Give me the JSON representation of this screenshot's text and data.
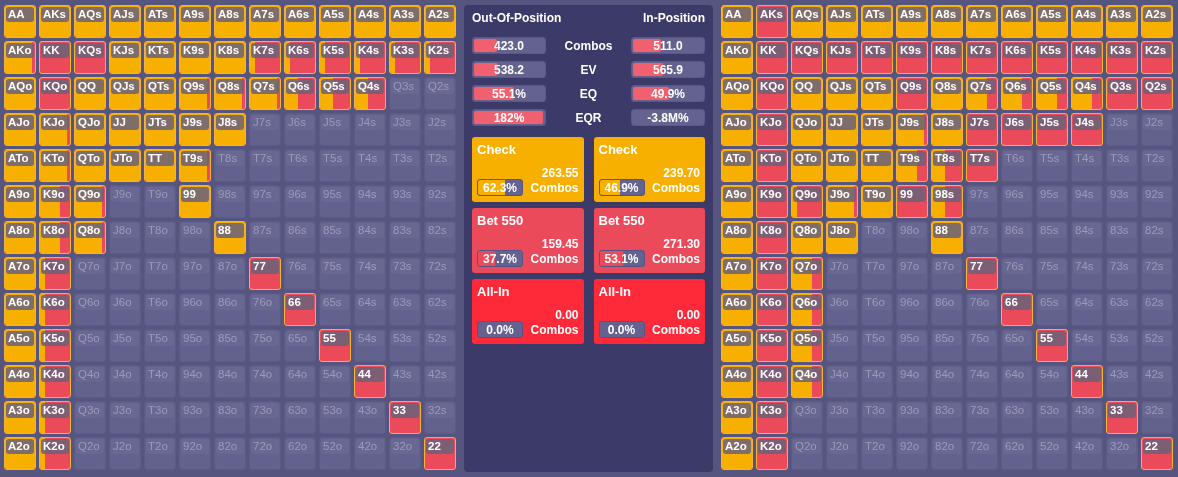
{
  "oop_grid": [
    [
      {
        "hand": "AA",
        "active": true,
        "kind": "check"
      },
      {
        "hand": "AKs",
        "active": true,
        "kind": "check"
      },
      {
        "hand": "AQs",
        "active": true,
        "kind": "check"
      },
      {
        "hand": "AJs",
        "active": true,
        "kind": "check"
      },
      {
        "hand": "ATs",
        "active": true,
        "kind": "check"
      },
      {
        "hand": "A9s",
        "active": true,
        "kind": "check"
      },
      {
        "hand": "A8s",
        "active": true,
        "kind": "check"
      },
      {
        "hand": "A7s",
        "active": true,
        "kind": "check"
      },
      {
        "hand": "A6s",
        "active": true,
        "kind": "check"
      },
      {
        "hand": "A5s",
        "active": true,
        "kind": "check"
      },
      {
        "hand": "A4s",
        "active": true,
        "kind": "check"
      },
      {
        "hand": "A3s",
        "active": true,
        "kind": "check"
      },
      {
        "hand": "A2s",
        "active": true,
        "kind": "check"
      }
    ],
    [
      {
        "hand": "AKo",
        "active": true,
        "kind": "mostly_check"
      },
      {
        "hand": "KK",
        "active": true,
        "kind": "bet"
      },
      {
        "hand": "KQs",
        "active": true,
        "kind": "bet"
      },
      {
        "hand": "KJs",
        "active": true,
        "kind": "check"
      },
      {
        "hand": "KTs",
        "active": true,
        "kind": "check"
      },
      {
        "hand": "K9s",
        "active": true,
        "kind": "check"
      },
      {
        "hand": "K8s",
        "active": true,
        "kind": "check"
      },
      {
        "hand": "K7s",
        "active": true,
        "kind": "mostly_bet"
      },
      {
        "hand": "K6s",
        "active": true,
        "kind": "mostly_bet"
      },
      {
        "hand": "K5s",
        "active": true,
        "kind": "mostly_bet"
      },
      {
        "hand": "K4s",
        "active": true,
        "kind": "mostly_bet"
      },
      {
        "hand": "K3s",
        "active": true,
        "kind": "mostly_bet"
      },
      {
        "hand": "K2s",
        "active": true,
        "kind": "mostly_bet"
      }
    ],
    [
      {
        "hand": "AQo",
        "active": true,
        "kind": "check"
      },
      {
        "hand": "KQo",
        "active": true,
        "kind": "bet"
      },
      {
        "hand": "QQ",
        "active": true,
        "kind": "check"
      },
      {
        "hand": "QJs",
        "active": true,
        "kind": "check"
      },
      {
        "hand": "QTs",
        "active": true,
        "kind": "check"
      },
      {
        "hand": "Q9s",
        "active": true,
        "kind": "mostly_check"
      },
      {
        "hand": "Q8s",
        "active": true,
        "kind": "mostly_check"
      },
      {
        "hand": "Q7s",
        "active": true,
        "kind": "mostly_check"
      },
      {
        "hand": "Q6s",
        "active": true,
        "kind": "split"
      },
      {
        "hand": "Q5s",
        "active": true,
        "kind": "split"
      },
      {
        "hand": "Q4s",
        "active": true,
        "kind": "split"
      },
      {
        "hand": "Q3s",
        "active": false
      },
      {
        "hand": "Q2s",
        "active": false
      }
    ],
    [
      {
        "hand": "AJo",
        "active": true,
        "kind": "check"
      },
      {
        "hand": "KJo",
        "active": true,
        "kind": "mostly_check"
      },
      {
        "hand": "QJo",
        "active": true,
        "kind": "check"
      },
      {
        "hand": "JJ",
        "active": true,
        "kind": "check"
      },
      {
        "hand": "JTs",
        "active": true,
        "kind": "check"
      },
      {
        "hand": "J9s",
        "active": true,
        "kind": "check"
      },
      {
        "hand": "J8s",
        "active": true,
        "kind": "check"
      },
      {
        "hand": "J7s",
        "active": false
      },
      {
        "hand": "J6s",
        "active": false
      },
      {
        "hand": "J5s",
        "active": false
      },
      {
        "hand": "J4s",
        "active": false
      },
      {
        "hand": "J3s",
        "active": false
      },
      {
        "hand": "J2s",
        "active": false
      }
    ],
    [
      {
        "hand": "ATo",
        "active": true,
        "kind": "check"
      },
      {
        "hand": "KTo",
        "active": true,
        "kind": "mostly_check"
      },
      {
        "hand": "QTo",
        "active": true,
        "kind": "check"
      },
      {
        "hand": "JTo",
        "active": true,
        "kind": "check"
      },
      {
        "hand": "TT",
        "active": true,
        "kind": "check"
      },
      {
        "hand": "T9s",
        "active": true,
        "kind": "mostly_check"
      },
      {
        "hand": "T8s",
        "active": false
      },
      {
        "hand": "T7s",
        "active": false
      },
      {
        "hand": "T6s",
        "active": false
      },
      {
        "hand": "T5s",
        "active": false
      },
      {
        "hand": "T4s",
        "active": false
      },
      {
        "hand": "T3s",
        "active": false
      },
      {
        "hand": "T2s",
        "active": false
      }
    ],
    [
      {
        "hand": "A9o",
        "active": true,
        "kind": "check"
      },
      {
        "hand": "K9o",
        "active": true,
        "kind": "check_bet"
      },
      {
        "hand": "Q9o",
        "active": true,
        "kind": "mostly_check"
      },
      {
        "hand": "J9o",
        "active": false
      },
      {
        "hand": "T9o",
        "active": false
      },
      {
        "hand": "99",
        "active": true,
        "kind": "check"
      },
      {
        "hand": "98s",
        "active": false
      },
      {
        "hand": "97s",
        "active": false
      },
      {
        "hand": "96s",
        "active": false
      },
      {
        "hand": "95s",
        "active": false
      },
      {
        "hand": "94s",
        "active": false
      },
      {
        "hand": "93s",
        "active": false
      },
      {
        "hand": "92s",
        "active": false
      }
    ],
    [
      {
        "hand": "A8o",
        "active": true,
        "kind": "check"
      },
      {
        "hand": "K8o",
        "active": true,
        "kind": "check_bet"
      },
      {
        "hand": "Q8o",
        "active": true,
        "kind": "mostly_check"
      },
      {
        "hand": "J8o",
        "active": false
      },
      {
        "hand": "T8o",
        "active": false
      },
      {
        "hand": "98o",
        "active": false
      },
      {
        "hand": "88",
        "active": true,
        "kind": "check"
      },
      {
        "hand": "87s",
        "active": false
      },
      {
        "hand": "86s",
        "active": false
      },
      {
        "hand": "85s",
        "active": false
      },
      {
        "hand": "84s",
        "active": false
      },
      {
        "hand": "83s",
        "active": false
      },
      {
        "hand": "82s",
        "active": false
      }
    ],
    [
      {
        "hand": "A7o",
        "active": true,
        "kind": "check"
      },
      {
        "hand": "K7o",
        "active": true,
        "kind": "mostly_bet"
      },
      {
        "hand": "Q7o",
        "active": false
      },
      {
        "hand": "J7o",
        "active": false
      },
      {
        "hand": "T7o",
        "active": false
      },
      {
        "hand": "97o",
        "active": false
      },
      {
        "hand": "87o",
        "active": false
      },
      {
        "hand": "77",
        "active": true,
        "kind": "bet"
      },
      {
        "hand": "76s",
        "active": false
      },
      {
        "hand": "75s",
        "active": false
      },
      {
        "hand": "74s",
        "active": false
      },
      {
        "hand": "73s",
        "active": false
      },
      {
        "hand": "72s",
        "active": false
      }
    ],
    [
      {
        "hand": "A6o",
        "active": true,
        "kind": "check"
      },
      {
        "hand": "K6o",
        "active": true,
        "kind": "mostly_bet"
      },
      {
        "hand": "Q6o",
        "active": false
      },
      {
        "hand": "J6o",
        "active": false
      },
      {
        "hand": "T6o",
        "active": false
      },
      {
        "hand": "96o",
        "active": false
      },
      {
        "hand": "86o",
        "active": false
      },
      {
        "hand": "76o",
        "active": false
      },
      {
        "hand": "66",
        "active": true,
        "kind": "bet"
      },
      {
        "hand": "65s",
        "active": false
      },
      {
        "hand": "64s",
        "active": false
      },
      {
        "hand": "63s",
        "active": false
      },
      {
        "hand": "62s",
        "active": false
      }
    ],
    [
      {
        "hand": "A5o",
        "active": true,
        "kind": "check"
      },
      {
        "hand": "K5o",
        "active": true,
        "kind": "mostly_bet"
      },
      {
        "hand": "Q5o",
        "active": false
      },
      {
        "hand": "J5o",
        "active": false
      },
      {
        "hand": "T5o",
        "active": false
      },
      {
        "hand": "95o",
        "active": false
      },
      {
        "hand": "85o",
        "active": false
      },
      {
        "hand": "75o",
        "active": false
      },
      {
        "hand": "65o",
        "active": false
      },
      {
        "hand": "55",
        "active": true,
        "kind": "bet"
      },
      {
        "hand": "54s",
        "active": false
      },
      {
        "hand": "53s",
        "active": false
      },
      {
        "hand": "52s",
        "active": false
      }
    ],
    [
      {
        "hand": "A4o",
        "active": true,
        "kind": "check"
      },
      {
        "hand": "K4o",
        "active": true,
        "kind": "mostly_bet"
      },
      {
        "hand": "Q4o",
        "active": false
      },
      {
        "hand": "J4o",
        "active": false
      },
      {
        "hand": "T4o",
        "active": false
      },
      {
        "hand": "94o",
        "active": false
      },
      {
        "hand": "84o",
        "active": false
      },
      {
        "hand": "74o",
        "active": false
      },
      {
        "hand": "64o",
        "active": false
      },
      {
        "hand": "54o",
        "active": false
      },
      {
        "hand": "44",
        "active": true,
        "kind": "bet"
      },
      {
        "hand": "43s",
        "active": false
      },
      {
        "hand": "42s",
        "active": false
      }
    ],
    [
      {
        "hand": "A3o",
        "active": true,
        "kind": "check"
      },
      {
        "hand": "K3o",
        "active": true,
        "kind": "mostly_bet"
      },
      {
        "hand": "Q3o",
        "active": false
      },
      {
        "hand": "J3o",
        "active": false
      },
      {
        "hand": "T3o",
        "active": false
      },
      {
        "hand": "93o",
        "active": false
      },
      {
        "hand": "83o",
        "active": false
      },
      {
        "hand": "73o",
        "active": false
      },
      {
        "hand": "63o",
        "active": false
      },
      {
        "hand": "53o",
        "active": false
      },
      {
        "hand": "43o",
        "active": false
      },
      {
        "hand": "33",
        "active": true,
        "kind": "bet"
      },
      {
        "hand": "32s",
        "active": false
      }
    ],
    [
      {
        "hand": "A2o",
        "active": true,
        "kind": "check"
      },
      {
        "hand": "K2o",
        "active": true,
        "kind": "mostly_bet"
      },
      {
        "hand": "Q2o",
        "active": false
      },
      {
        "hand": "J2o",
        "active": false
      },
      {
        "hand": "T2o",
        "active": false
      },
      {
        "hand": "92o",
        "active": false
      },
      {
        "hand": "82o",
        "active": false
      },
      {
        "hand": "72o",
        "active": false
      },
      {
        "hand": "62o",
        "active": false
      },
      {
        "hand": "52o",
        "active": false
      },
      {
        "hand": "42o",
        "active": false
      },
      {
        "hand": "32o",
        "active": false
      },
      {
        "hand": "22",
        "active": true,
        "kind": "bet"
      }
    ]
  ],
  "panel": {
    "oop_title": "Out-Of-Position",
    "ip_title": "In-Position",
    "stats": [
      {
        "label": "Combos",
        "oop": {
          "value": "423.0",
          "level": 0.32
        },
        "ip": {
          "value": "511.0",
          "level": 0.39
        }
      },
      {
        "label": "EV",
        "oop": {
          "value": "538.2",
          "level": 0.34
        },
        "ip": {
          "value": "565.9",
          "level": 0.41
        }
      },
      {
        "label": "EQ",
        "oop": {
          "value": "55.1%",
          "level": 0.551
        },
        "ip": {
          "value": "49.9%",
          "level": 0.499
        }
      },
      {
        "label": "EQR",
        "oop": {
          "value": "182%",
          "level": 1
        },
        "ip": {
          "value": "-3.8M%"
        }
      }
    ],
    "oop_actions": [
      {
        "name": "Check",
        "color": "#f8b000",
        "combos": "263.55",
        "combos_label": "Combos",
        "percent": "62.3%",
        "level": 0.623
      },
      {
        "name": "Bet 550",
        "color": "#eb4a5a",
        "combos": "159.45",
        "combos_label": "Combos",
        "percent": "37.7%",
        "level": 0.377
      },
      {
        "name": "All-In",
        "color": "#fe2a3a",
        "combos": "0.00",
        "combos_label": "Combos",
        "percent": "0.0%"
      }
    ],
    "ip_actions": [
      {
        "name": "Check",
        "color": "#f8b000",
        "combos": "239.70",
        "combos_label": "Combos",
        "percent": "46.9%",
        "level": 0.469
      },
      {
        "name": "Bet 550",
        "color": "#eb4a5a",
        "combos": "271.30",
        "combos_label": "Combos",
        "percent": "53.1%",
        "level": 0.531
      },
      {
        "name": "All-In",
        "color": "#fe2a3a",
        "combos": "0.00",
        "combos_label": "Combos",
        "percent": "0.0%"
      }
    ]
  },
  "ip_grid": [
    [
      {
        "hand": "AA",
        "active": true,
        "kind": "check"
      },
      {
        "hand": "AKs",
        "active": true,
        "kind": "bet"
      },
      {
        "hand": "AQs",
        "active": true,
        "kind": "check"
      },
      {
        "hand": "AJs",
        "active": true,
        "kind": "check"
      },
      {
        "hand": "ATs",
        "active": true,
        "kind": "check"
      },
      {
        "hand": "A9s",
        "active": true,
        "kind": "check"
      },
      {
        "hand": "A8s",
        "active": true,
        "kind": "check"
      },
      {
        "hand": "A7s",
        "active": true,
        "kind": "check"
      },
      {
        "hand": "A6s",
        "active": true,
        "kind": "check"
      },
      {
        "hand": "A5s",
        "active": true,
        "kind": "check"
      },
      {
        "hand": "A4s",
        "active": true,
        "kind": "check"
      },
      {
        "hand": "A3s",
        "active": true,
        "kind": "check"
      },
      {
        "hand": "A2s",
        "active": true,
        "kind": "check"
      }
    ],
    [
      {
        "hand": "AKo",
        "active": true,
        "kind": "check"
      },
      {
        "hand": "KK",
        "active": true,
        "kind": "bet"
      },
      {
        "hand": "KQs",
        "active": true,
        "kind": "bet"
      },
      {
        "hand": "KJs",
        "active": true,
        "kind": "bet"
      },
      {
        "hand": "KTs",
        "active": true,
        "kind": "bet"
      },
      {
        "hand": "K9s",
        "active": true,
        "kind": "bet"
      },
      {
        "hand": "K8s",
        "active": true,
        "kind": "bet"
      },
      {
        "hand": "K7s",
        "active": true,
        "kind": "bet"
      },
      {
        "hand": "K6s",
        "active": true,
        "kind": "bet"
      },
      {
        "hand": "K5s",
        "active": true,
        "kind": "bet"
      },
      {
        "hand": "K4s",
        "active": true,
        "kind": "bet"
      },
      {
        "hand": "K3s",
        "active": true,
        "kind": "bet"
      },
      {
        "hand": "K2s",
        "active": true,
        "kind": "bet"
      }
    ],
    [
      {
        "hand": "AQo",
        "active": true,
        "kind": "check"
      },
      {
        "hand": "KQo",
        "active": true,
        "kind": "bet"
      },
      {
        "hand": "QQ",
        "active": true,
        "kind": "check"
      },
      {
        "hand": "QJs",
        "active": true,
        "kind": "check"
      },
      {
        "hand": "QTs",
        "active": true,
        "kind": "check"
      },
      {
        "hand": "Q9s",
        "active": true,
        "kind": "bet"
      },
      {
        "hand": "Q8s",
        "active": true,
        "kind": "check"
      },
      {
        "hand": "Q7s",
        "active": true,
        "kind": "check_bet"
      },
      {
        "hand": "Q6s",
        "active": true,
        "kind": "check_bet"
      },
      {
        "hand": "Q5s",
        "active": true,
        "kind": "check_bet"
      },
      {
        "hand": "Q4s",
        "active": true,
        "kind": "check_bet"
      },
      {
        "hand": "Q3s",
        "active": true,
        "kind": "bet"
      },
      {
        "hand": "Q2s",
        "active": true,
        "kind": "bet"
      }
    ],
    [
      {
        "hand": "AJo",
        "active": true,
        "kind": "check"
      },
      {
        "hand": "KJo",
        "active": true,
        "kind": "bet"
      },
      {
        "hand": "QJo",
        "active": true,
        "kind": "check"
      },
      {
        "hand": "JJ",
        "active": true,
        "kind": "check"
      },
      {
        "hand": "JTs",
        "active": true,
        "kind": "check"
      },
      {
        "hand": "J9s",
        "active": true,
        "kind": "mostly_check"
      },
      {
        "hand": "J8s",
        "active": true,
        "kind": "check"
      },
      {
        "hand": "J7s",
        "active": true,
        "kind": "bet"
      },
      {
        "hand": "J6s",
        "active": true,
        "kind": "bet"
      },
      {
        "hand": "J5s",
        "active": true,
        "kind": "bet"
      },
      {
        "hand": "J4s",
        "active": true,
        "kind": "bet"
      },
      {
        "hand": "J3s",
        "active": false
      },
      {
        "hand": "J2s",
        "active": false
      }
    ],
    [
      {
        "hand": "ATo",
        "active": true,
        "kind": "check"
      },
      {
        "hand": "KTo",
        "active": true,
        "kind": "bet"
      },
      {
        "hand": "QTo",
        "active": true,
        "kind": "check"
      },
      {
        "hand": "JTo",
        "active": true,
        "kind": "check"
      },
      {
        "hand": "TT",
        "active": true,
        "kind": "check"
      },
      {
        "hand": "T9s",
        "active": true,
        "kind": "check_bet"
      },
      {
        "hand": "T8s",
        "active": true,
        "kind": "split"
      },
      {
        "hand": "T7s",
        "active": true,
        "kind": "bet"
      },
      {
        "hand": "T6s",
        "active": false
      },
      {
        "hand": "T5s",
        "active": false
      },
      {
        "hand": "T4s",
        "active": false
      },
      {
        "hand": "T3s",
        "active": false
      },
      {
        "hand": "T2s",
        "active": false
      }
    ],
    [
      {
        "hand": "A9o",
        "active": true,
        "kind": "check"
      },
      {
        "hand": "K9o",
        "active": true,
        "kind": "bet"
      },
      {
        "hand": "Q9o",
        "active": true,
        "kind": "mostly_bet"
      },
      {
        "hand": "J9o",
        "active": true,
        "kind": "mostly_check"
      },
      {
        "hand": "T9o",
        "active": true,
        "kind": "check"
      },
      {
        "hand": "99",
        "active": true,
        "kind": "bet"
      },
      {
        "hand": "98s",
        "active": true,
        "kind": "split"
      },
      {
        "hand": "97s",
        "active": false
      },
      {
        "hand": "96s",
        "active": false
      },
      {
        "hand": "95s",
        "active": false
      },
      {
        "hand": "94s",
        "active": false
      },
      {
        "hand": "93s",
        "active": false
      },
      {
        "hand": "92s",
        "active": false
      }
    ],
    [
      {
        "hand": "A8o",
        "active": true,
        "kind": "check"
      },
      {
        "hand": "K8o",
        "active": true,
        "kind": "bet"
      },
      {
        "hand": "Q8o",
        "active": true,
        "kind": "check"
      },
      {
        "hand": "J8o",
        "active": true,
        "kind": "check"
      },
      {
        "hand": "T8o",
        "active": false
      },
      {
        "hand": "98o",
        "active": false
      },
      {
        "hand": "88",
        "active": true,
        "kind": "check"
      },
      {
        "hand": "87s",
        "active": false
      },
      {
        "hand": "86s",
        "active": false
      },
      {
        "hand": "85s",
        "active": false
      },
      {
        "hand": "84s",
        "active": false
      },
      {
        "hand": "83s",
        "active": false
      },
      {
        "hand": "82s",
        "active": false
      }
    ],
    [
      {
        "hand": "A7o",
        "active": true,
        "kind": "check"
      },
      {
        "hand": "K7o",
        "active": true,
        "kind": "bet"
      },
      {
        "hand": "Q7o",
        "active": true,
        "kind": "check_bet"
      },
      {
        "hand": "J7o",
        "active": false
      },
      {
        "hand": "T7o",
        "active": false
      },
      {
        "hand": "97o",
        "active": false
      },
      {
        "hand": "87o",
        "active": false
      },
      {
        "hand": "77",
        "active": true,
        "kind": "bet"
      },
      {
        "hand": "76s",
        "active": false
      },
      {
        "hand": "75s",
        "active": false
      },
      {
        "hand": "74s",
        "active": false
      },
      {
        "hand": "73s",
        "active": false
      },
      {
        "hand": "72s",
        "active": false
      }
    ],
    [
      {
        "hand": "A6o",
        "active": true,
        "kind": "check"
      },
      {
        "hand": "K6o",
        "active": true,
        "kind": "bet"
      },
      {
        "hand": "Q6o",
        "active": true,
        "kind": "check_bet"
      },
      {
        "hand": "J6o",
        "active": false
      },
      {
        "hand": "T6o",
        "active": false
      },
      {
        "hand": "96o",
        "active": false
      },
      {
        "hand": "86o",
        "active": false
      },
      {
        "hand": "76o",
        "active": false
      },
      {
        "hand": "66",
        "active": true,
        "kind": "bet"
      },
      {
        "hand": "65s",
        "active": false
      },
      {
        "hand": "64s",
        "active": false
      },
      {
        "hand": "63s",
        "active": false
      },
      {
        "hand": "62s",
        "active": false
      }
    ],
    [
      {
        "hand": "A5o",
        "active": true,
        "kind": "check"
      },
      {
        "hand": "K5o",
        "active": true,
        "kind": "bet"
      },
      {
        "hand": "Q5o",
        "active": true,
        "kind": "check_bet"
      },
      {
        "hand": "J5o",
        "active": false
      },
      {
        "hand": "T5o",
        "active": false
      },
      {
        "hand": "95o",
        "active": false
      },
      {
        "hand": "85o",
        "active": false
      },
      {
        "hand": "75o",
        "active": false
      },
      {
        "hand": "65o",
        "active": false
      },
      {
        "hand": "55",
        "active": true,
        "kind": "bet"
      },
      {
        "hand": "54s",
        "active": false
      },
      {
        "hand": "53s",
        "active": false
      },
      {
        "hand": "52s",
        "active": false
      }
    ],
    [
      {
        "hand": "A4o",
        "active": true,
        "kind": "check"
      },
      {
        "hand": "K4o",
        "active": true,
        "kind": "bet"
      },
      {
        "hand": "Q4o",
        "active": true,
        "kind": "check_bet"
      },
      {
        "hand": "J4o",
        "active": false
      },
      {
        "hand": "T4o",
        "active": false
      },
      {
        "hand": "94o",
        "active": false
      },
      {
        "hand": "84o",
        "active": false
      },
      {
        "hand": "74o",
        "active": false
      },
      {
        "hand": "64o",
        "active": false
      },
      {
        "hand": "54o",
        "active": false
      },
      {
        "hand": "44",
        "active": true,
        "kind": "bet"
      },
      {
        "hand": "43s",
        "active": false
      },
      {
        "hand": "42s",
        "active": false
      }
    ],
    [
      {
        "hand": "A3o",
        "active": true,
        "kind": "check"
      },
      {
        "hand": "K3o",
        "active": true,
        "kind": "bet"
      },
      {
        "hand": "Q3o",
        "active": false
      },
      {
        "hand": "J3o",
        "active": false
      },
      {
        "hand": "T3o",
        "active": false
      },
      {
        "hand": "93o",
        "active": false
      },
      {
        "hand": "83o",
        "active": false
      },
      {
        "hand": "73o",
        "active": false
      },
      {
        "hand": "63o",
        "active": false
      },
      {
        "hand": "53o",
        "active": false
      },
      {
        "hand": "43o",
        "active": false
      },
      {
        "hand": "33",
        "active": true,
        "kind": "bet"
      },
      {
        "hand": "32s",
        "active": false
      }
    ],
    [
      {
        "hand": "A2o",
        "active": true,
        "kind": "check"
      },
      {
        "hand": "K2o",
        "active": true,
        "kind": "bet"
      },
      {
        "hand": "Q2o",
        "active": false
      },
      {
        "hand": "J2o",
        "active": false
      },
      {
        "hand": "T2o",
        "active": false
      },
      {
        "hand": "92o",
        "active": false
      },
      {
        "hand": "82o",
        "active": false
      },
      {
        "hand": "72o",
        "active": false
      },
      {
        "hand": "62o",
        "active": false
      },
      {
        "hand": "52o",
        "active": false
      },
      {
        "hand": "42o",
        "active": false
      },
      {
        "hand": "32o",
        "active": false
      },
      {
        "hand": "22",
        "active": true,
        "kind": "bet"
      }
    ]
  ]
}
